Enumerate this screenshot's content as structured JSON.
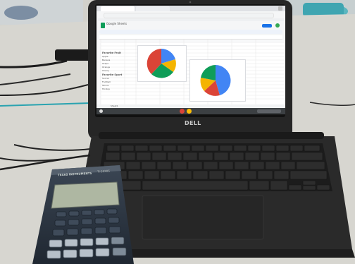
{
  "laptop": {
    "brand_label": "DELL",
    "screen": {
      "app_title": "Google Sheets",
      "table_header_1": "Favorite Fruit",
      "table_header_2": "Favorite Sport",
      "row_labels_1": [
        "Apple",
        "Banana",
        "Grape",
        "Orange",
        "Cherry"
      ],
      "row_labels_2": [
        "Soccer",
        "Football",
        "Tennis",
        "Hockey"
      ],
      "pie_chart_1": {
        "colors": [
          "#4285F4",
          "#F4B400",
          "#0F9D58",
          "#DB4437"
        ]
      },
      "pie_chart_2": {
        "colors": [
          "#4285F4",
          "#DB4437",
          "#0F9D58",
          "#F4B400"
        ]
      },
      "tab_label": "Sheet1"
    }
  },
  "calculator": {
    "brand_label": "TEXAS INSTRUMENTS",
    "model_label": "TI-30XIIS"
  },
  "colors": {
    "table": "#cfcfca",
    "laptop_shell": "#262626",
    "keyboard": "#202020",
    "sheet_bg": "#f5f6f7",
    "calculator_body": "#2c3743"
  }
}
